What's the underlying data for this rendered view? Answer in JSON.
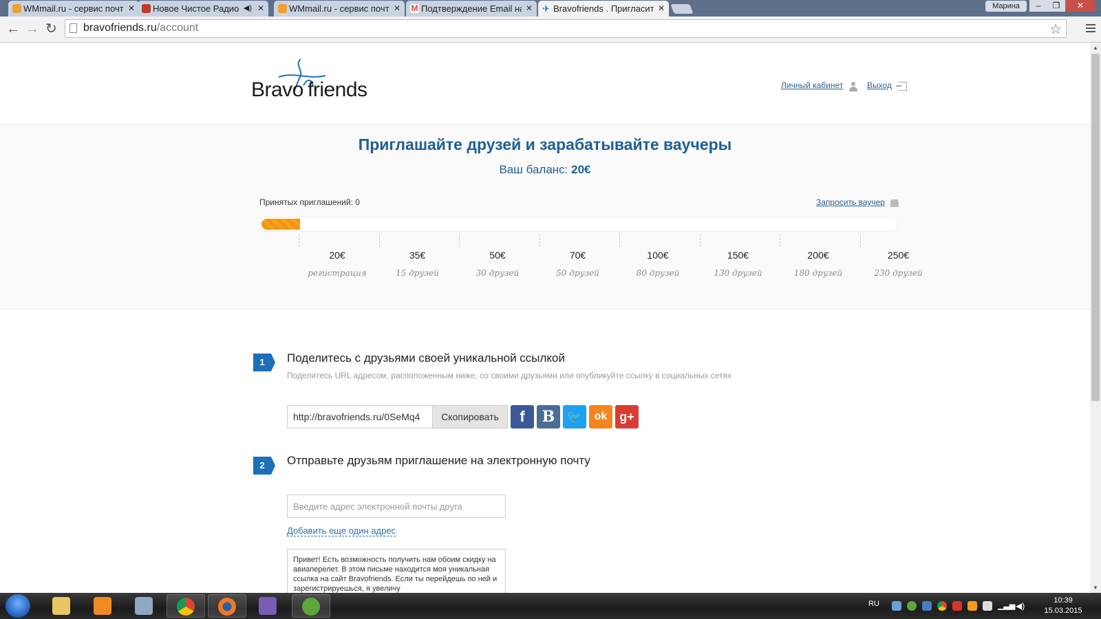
{
  "browser": {
    "tabs": [
      {
        "title": "WMmail.ru - сервис почт",
        "close": "✕",
        "color": "#f0a030"
      },
      {
        "title": "Новое Чистое Радио",
        "close": "✕",
        "color": "#c0392b"
      },
      {
        "title": "WMmail.ru - сервис почт",
        "close": "✕",
        "color": "#f0a030"
      },
      {
        "title": "Подтверждение Email на",
        "close": "✕",
        "color": "#d44638"
      },
      {
        "title": "Bravofriends . Пригласите",
        "close": "✕",
        "color": "#1d6fb8"
      }
    ],
    "user_badge": "Марина",
    "url_domain": "bravofriends.ru",
    "url_path": "/account"
  },
  "header": {
    "logo_left": "Bravo",
    "logo_right": "friends",
    "account_link": "Личный кабинет",
    "logout_link": "Выход"
  },
  "banner": {
    "title": "Приглашайте друзей и зарабатывайте ваучеры",
    "balance_label": "Ваш баланс: ",
    "balance_value": "20€",
    "accepted_invites": "Принятых приглашений: 0",
    "request_voucher": "Запросить ваучер",
    "progress_fraction": 0.06,
    "milestones": [
      {
        "amount": "20€",
        "sub": "регистрация"
      },
      {
        "amount": "35€",
        "sub": "15 друзей"
      },
      {
        "amount": "50€",
        "sub": "30 друзей"
      },
      {
        "amount": "70€",
        "sub": "50 друзей"
      },
      {
        "amount": "100€",
        "sub": "80 друзей"
      },
      {
        "amount": "150€",
        "sub": "130 друзей"
      },
      {
        "amount": "200€",
        "sub": "180 друзей"
      },
      {
        "amount": "250€",
        "sub": "230 друзей"
      }
    ]
  },
  "step1": {
    "number": "1",
    "title": "Поделитесь с друзьями своей уникальной ссылкой",
    "description": "Поделитесь URL адресом, расположенным ниже, со своими друзьями или опубликуйте ссылку в социальных сетях",
    "share_url": "http://bravofriends.ru/0SeMq4",
    "copy_label": "Скопировать",
    "socials": [
      {
        "name": "facebook-icon",
        "glyph": "f",
        "color": "#3b5998"
      },
      {
        "name": "vk-icon",
        "glyph": "B",
        "color": "#4a6d95"
      },
      {
        "name": "twitter-icon",
        "glyph": "🐦",
        "color": "#1da1f2"
      },
      {
        "name": "odnoklassniki-icon",
        "glyph": "ok",
        "color": "#f48420"
      },
      {
        "name": "google-plus-icon",
        "glyph": "g+",
        "color": "#d73d32"
      }
    ]
  },
  "step2": {
    "number": "2",
    "title": "Отправьте друзьям приглашение на электронную почту",
    "email_placeholder": "Введите адрес электронной почты друга",
    "add_address": "Добавить еще один адрес",
    "message": "Привет! Есть возможность получить нам обоим скидку на авиаперелет. В этом письме находится моя уникальная ссылка на сайт Bravofriends. Если ты перейдешь по ней и зарегистрируешься, я увеличу"
  },
  "taskbar": {
    "language": "RU",
    "time": "10:39",
    "date": "15.03.2015"
  }
}
